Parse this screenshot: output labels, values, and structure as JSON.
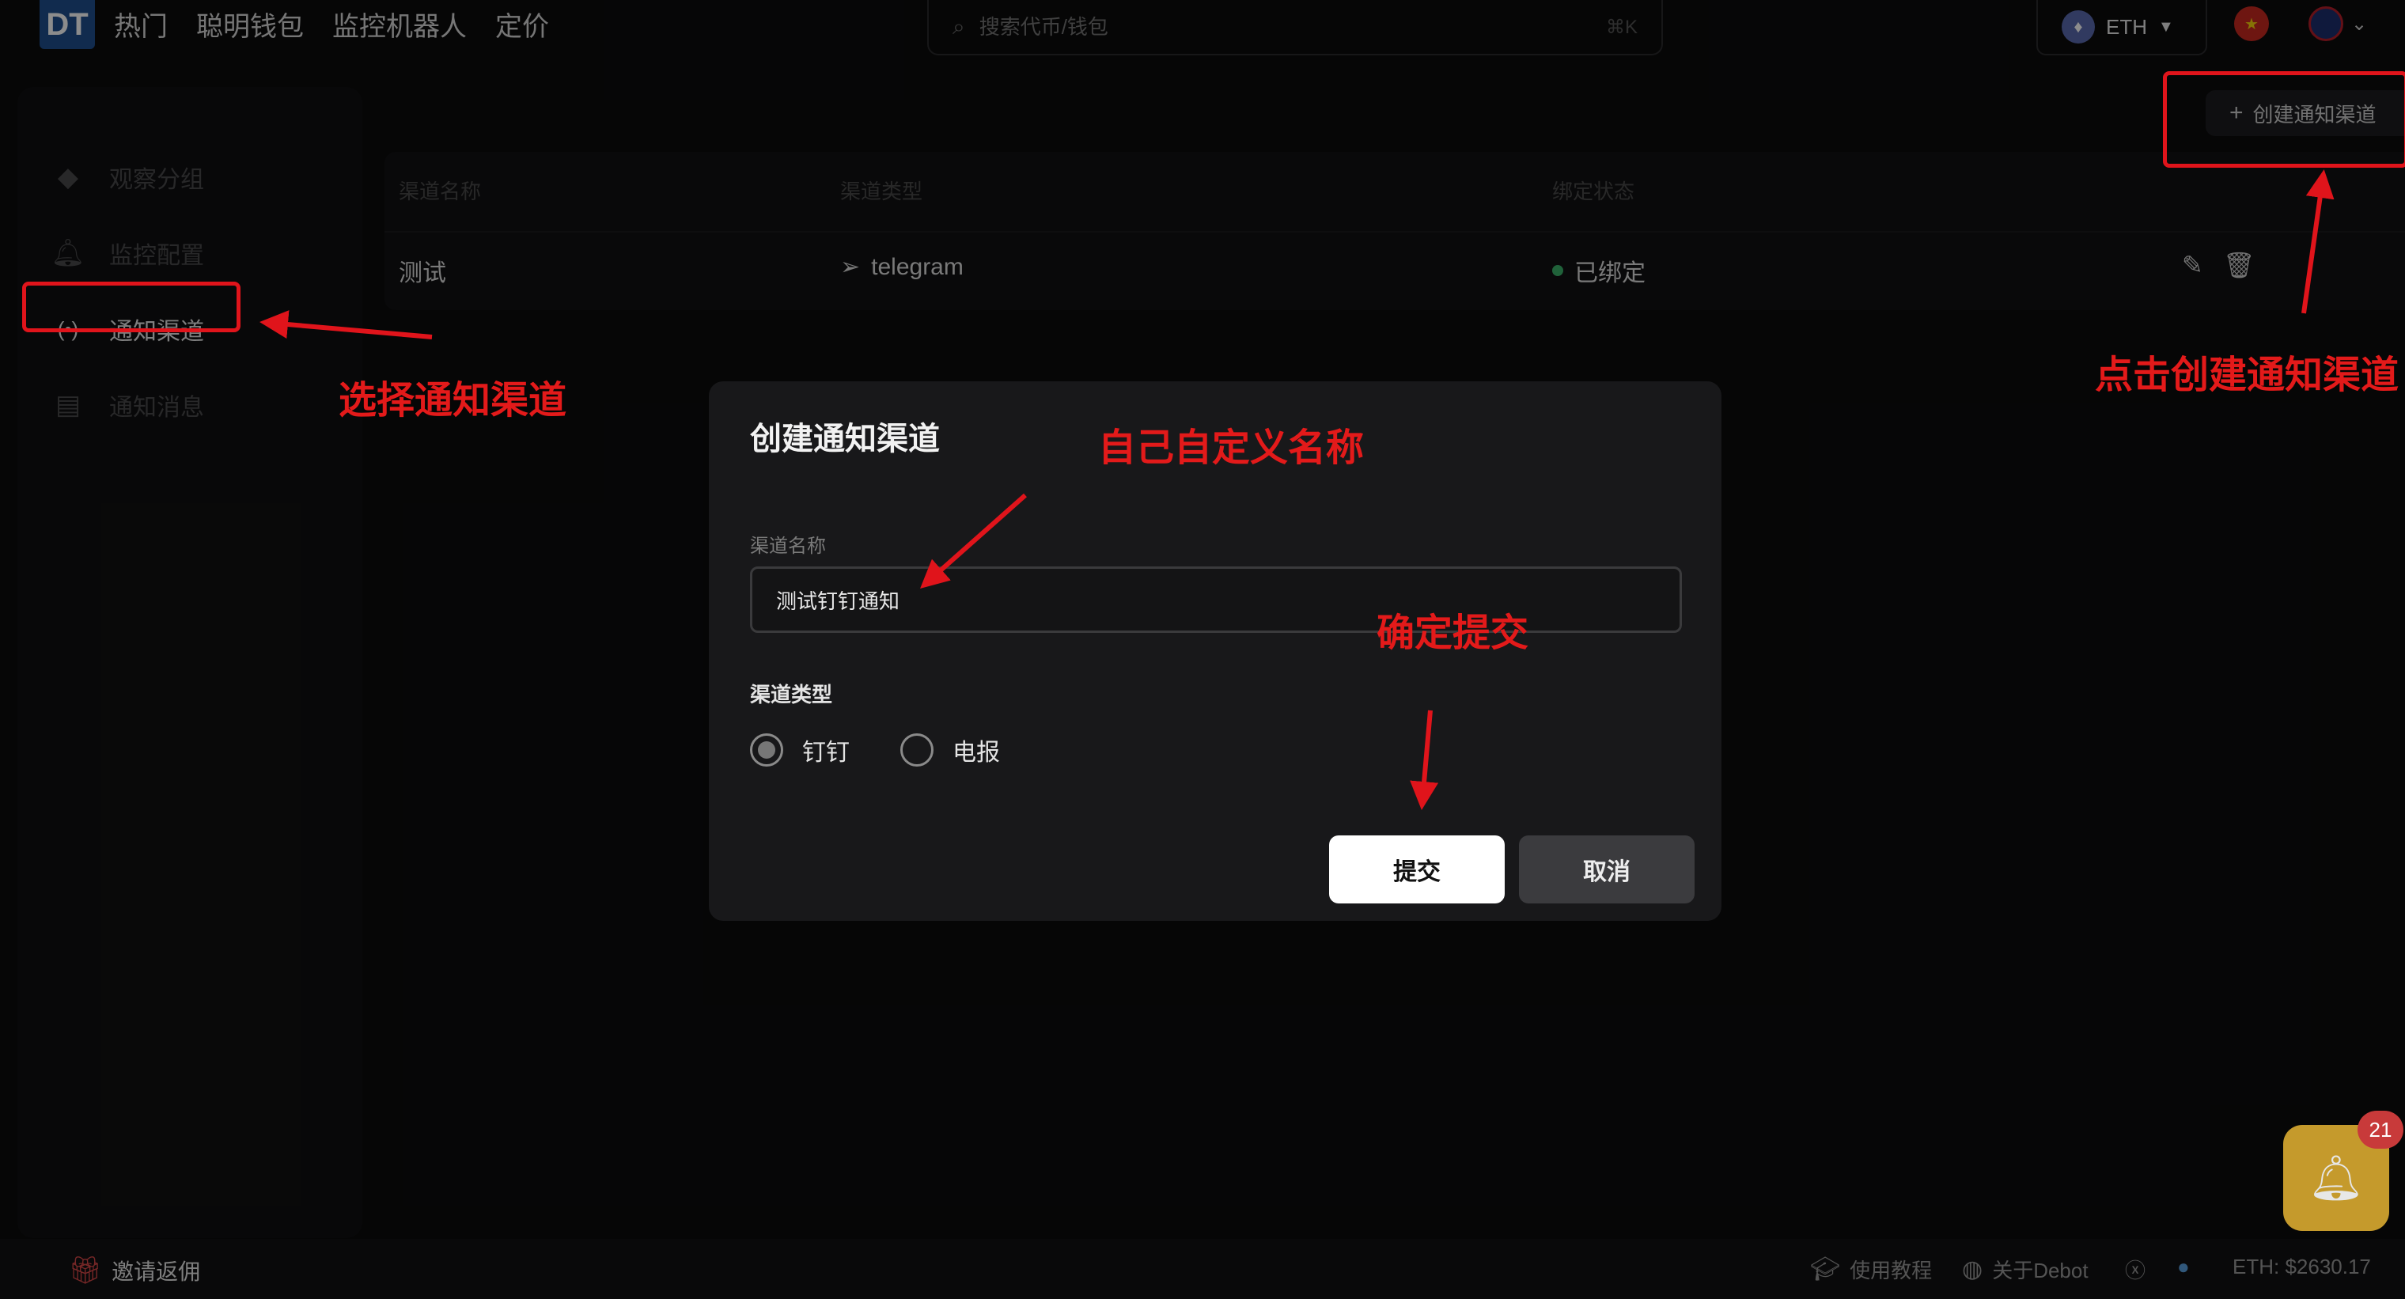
{
  "header": {
    "logo": "DT",
    "nav": [
      "热门",
      "聪明钱包",
      "监控机器人",
      "定价"
    ],
    "search_placeholder": "搜索代币/钱包",
    "search_shortcut": "⌘K",
    "chain": "ETH"
  },
  "sidebar": {
    "items": [
      {
        "label": "观察分组",
        "icon": "diamond-icon"
      },
      {
        "label": "监控配置",
        "icon": "bell-icon"
      },
      {
        "label": "通知渠道",
        "icon": "broadcast-icon",
        "active": true
      },
      {
        "label": "通知消息",
        "icon": "message-icon"
      }
    ]
  },
  "table": {
    "columns": [
      "渠道名称",
      "渠道类型",
      "绑定状态"
    ],
    "rows": [
      {
        "name": "测试",
        "type": "telegram",
        "status": "已绑定"
      }
    ]
  },
  "create_button": "创建通知渠道",
  "modal": {
    "title": "创建通知渠道",
    "name_label": "渠道名称",
    "name_value": "测试钉钉通知",
    "type_label": "渠道类型",
    "options": [
      "钉钉",
      "电报"
    ],
    "selected": "钉钉",
    "submit": "提交",
    "cancel": "取消"
  },
  "footer": {
    "invite": "邀请返佣",
    "tutorial": "使用教程",
    "about": "关于Debot",
    "eth_price": "ETH: $2630.17"
  },
  "notification_count": "21",
  "annotations": {
    "select_channel": "选择通知渠道",
    "click_create": "点击创建通知渠道",
    "custom_name": "自己自定义名称",
    "confirm_submit": "确定提交"
  },
  "colors": {
    "annotation": "#e0141b",
    "accent_gold": "#c59a2c",
    "bound_green": "#3bb36a"
  }
}
